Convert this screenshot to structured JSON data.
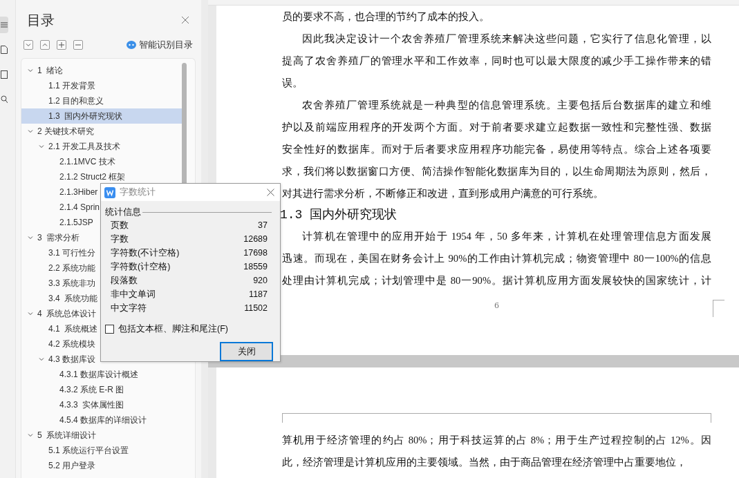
{
  "toc": {
    "title": "目录",
    "smart_button": "智能识别目录",
    "items": [
      {
        "label": "1  绪论",
        "selected": false,
        "expanded": true,
        "children": [
          {
            "label": "1.1 开发背景",
            "selected": false
          },
          {
            "label": "1.2 目的和意义",
            "selected": false
          },
          {
            "label": "1.3  国内外研究现状",
            "selected": true
          }
        ]
      },
      {
        "label": "2 关键技术研究",
        "selected": false,
        "expanded": true,
        "children": [
          {
            "label": "2.1 开发工具及技术",
            "selected": false,
            "expanded": true,
            "children": [
              {
                "label": "2.1.1MVC 技术",
                "selected": false
              },
              {
                "label": "2.1.2 Struct2 框架",
                "selected": false
              },
              {
                "label": "2.1.3Hiber",
                "selected": false
              },
              {
                "label": "2.1.4 Sprin",
                "selected": false
              },
              {
                "label": "2.1.5JSP",
                "selected": false
              }
            ]
          }
        ]
      },
      {
        "label": "3  需求分析",
        "selected": false,
        "expanded": true,
        "children": [
          {
            "label": "3.1 可行性分",
            "selected": false
          },
          {
            "label": "2.2 系统功能",
            "selected": false
          },
          {
            "label": "3.3 系统非功",
            "selected": false
          },
          {
            "label": "3.4  系统功能",
            "selected": false
          }
        ]
      },
      {
        "label": "4  系统总体设计",
        "selected": false,
        "expanded": true,
        "children": [
          {
            "label": "4.1  系统概述",
            "selected": false
          },
          {
            "label": "4.2 系统模块",
            "selected": false
          },
          {
            "label": "4.3 数据库设",
            "selected": false,
            "expanded": true,
            "children": [
              {
                "label": "4.3.1 数据库设计概述",
                "selected": false
              },
              {
                "label": "4.3.2 系统 E-R 图",
                "selected": false
              },
              {
                "label": "4.3.3  实体属性图",
                "selected": false
              },
              {
                "label": "4.5.4 数据库的详细设计",
                "selected": false
              }
            ]
          }
        ]
      },
      {
        "label": "5  系统详细设计",
        "selected": false,
        "expanded": true,
        "children": [
          {
            "label": "5.1 系统运行平台设置",
            "selected": false
          },
          {
            "label": "5.2 用户登录",
            "selected": false
          }
        ]
      }
    ]
  },
  "document": {
    "pages": [
      {
        "page_number": "6",
        "blocks": [
          {
            "kind": "paragraph",
            "indent": false,
            "continues": false,
            "lines": [
              "员的要求不高，也合理的节约了成本的投入。"
            ]
          },
          {
            "kind": "paragraph",
            "indent": true,
            "continues": false,
            "lines": [
              "因此我决定设计一个农舍养殖厂管理系统来解决这些问题，它实行了信息化管理，以",
              "提高了农舍养殖厂的管理水平和工作效率，同时也可以最大限度的减少手工操作带来的错",
              "误。"
            ]
          },
          {
            "kind": "paragraph",
            "indent": true,
            "continues": false,
            "lines": [
              "农舍养殖厂管理系统就是一种典型的信息管理系统。主要包括后台数据库的建立和维",
              "护以及前端应用程序的开发两个方面。对于前者要求建立起数据一致性和完整性强、数据",
              "安全性好的数据库。而对于后者要求应用程序功能完备，易使用等特点。综合上述各项要",
              "求，我们将以数据窗口方便、简洁操作智能化数据库为目的，以生命周期法为原则，然后，",
              "对其进行需求分析，不断修正和改进，直到形成用户满意的可行系统。"
            ]
          },
          {
            "kind": "heading",
            "text": "1.3 国内外研究现状"
          },
          {
            "kind": "paragraph",
            "indent": true,
            "continues": true,
            "lines": [
              "计算机在管理中的应用开始于 1954 年，50 多年来，计算机在处理管理信息方面发展",
              "迅速。而现在，美国在财务会计上 90%的工作由计算机完成；物资管理中 80一100%的信息",
              "处理由计算机完成；计划管理中是 80一90%。据计算机应用方面发展较快的国家统计，计"
            ]
          }
        ]
      },
      {
        "blocks": [
          {
            "kind": "paragraph",
            "indent": false,
            "continues": false,
            "lines": [
              "算机用于经济管理的约占 80%；用于科技运算的占 8%；用于生产过程控制的占 12%。因",
              "此，经济管理是计算机应用的主要领域。当然，由于商品管理在经济管理中占重要地位，"
            ]
          }
        ]
      }
    ]
  },
  "dialog": {
    "title": "字数统计",
    "group_title": "统计信息",
    "stats": [
      {
        "label": "页数",
        "value": "37"
      },
      {
        "label": "字数",
        "value": "12689"
      },
      {
        "label": "字符数(不计空格)",
        "value": "17698"
      },
      {
        "label": "字符数(计空格)",
        "value": "18559"
      },
      {
        "label": "段落数",
        "value": "920"
      },
      {
        "label": "非中文单词",
        "value": "1187"
      },
      {
        "label": "中文字符",
        "value": "11502"
      }
    ],
    "checkbox": {
      "label": "包括文本框、脚注和尾注(F)",
      "checked": false
    },
    "button": "关闭"
  }
}
